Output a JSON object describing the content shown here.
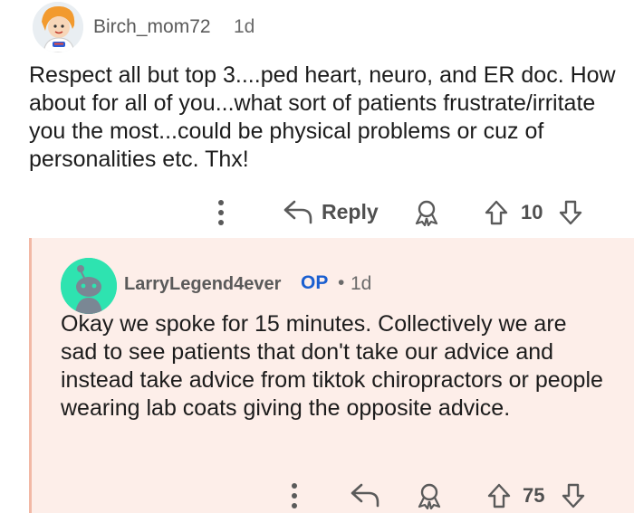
{
  "comment1": {
    "username": "Birch_mom72",
    "time": "1d",
    "body": "Respect all but top 3....ped heart, neuro, and ER doc. How about for all of you...what sort of patients frustrate/irritate you the most...could be physical problems or cuz of personalities etc. Thx!",
    "reply_label": "Reply",
    "vote_count": "10"
  },
  "comment2": {
    "username": "LarryLegend4ever",
    "op_badge": "OP",
    "separator": "•",
    "time": "1d",
    "body": "Okay we spoke for 15 minutes. Collectively we are sad to see patients that don't take our advice and instead take advice from tiktok chiropractors or people wearing lab coats giving the opposite advice.",
    "vote_count": "75"
  },
  "colors": {
    "reply_background": "#fdeee9",
    "thread_line": "#f2b8a5",
    "op_badge": "#1a5fd0",
    "snoo_avatar": "#2ee3b0"
  },
  "icons": [
    "more-options-icon",
    "reply-arrow-icon",
    "award-icon",
    "upvote-arrow-icon",
    "downvote-arrow-icon"
  ]
}
